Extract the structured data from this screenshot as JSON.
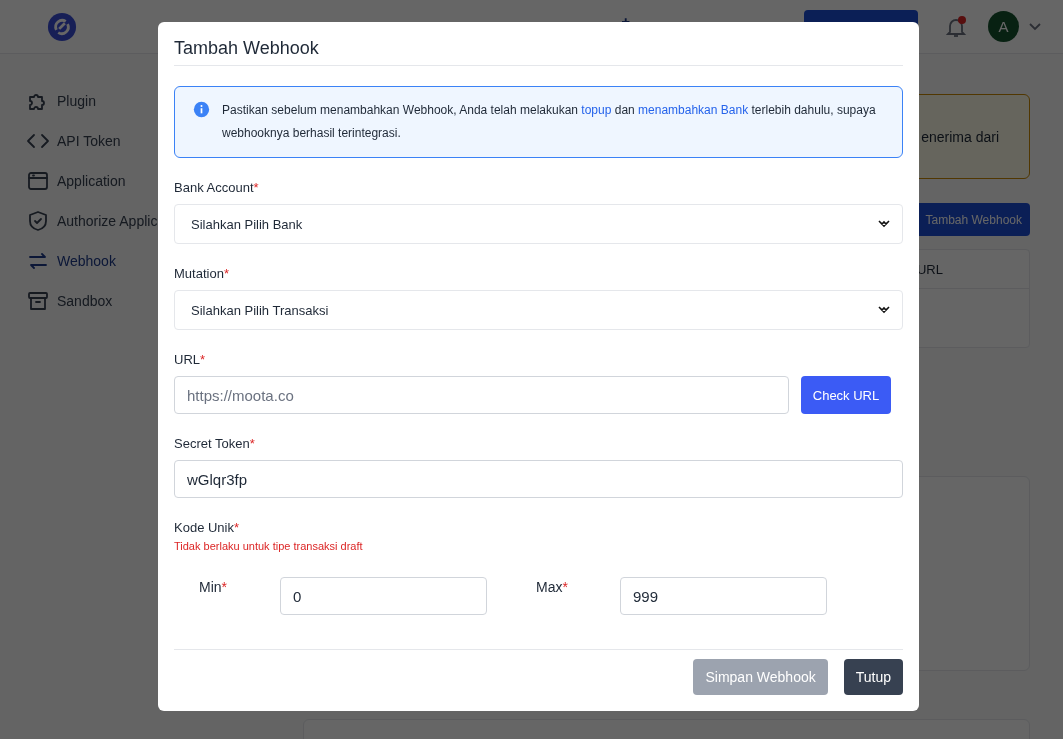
{
  "header": {
    "notification": true,
    "avatar": "A"
  },
  "sidebar": {
    "items": [
      {
        "label": "Plugin",
        "selected": false
      },
      {
        "label": "API Token",
        "selected": false
      },
      {
        "label": "Application",
        "selected": false
      },
      {
        "label": "Authorize Applic",
        "selected": false
      },
      {
        "label": "Webhook",
        "selected": true
      },
      {
        "label": "Sandbox",
        "selected": false
      }
    ]
  },
  "page": {
    "alert_text": "enerima dari",
    "add_button": "Tambah Webhook",
    "table": {
      "columns": [
        "URL"
      ]
    }
  },
  "modal": {
    "title": "Tambah Webhook",
    "info": [
      {
        "kind": "text",
        "text": "Pastikan sebelum menambahkan Webhook, Anda telah melakukan "
      },
      {
        "kind": "link",
        "text": "topup"
      },
      {
        "kind": "text",
        "text": " dan "
      },
      {
        "kind": "link",
        "text": "menambahkan Bank"
      },
      {
        "kind": "text",
        "text": " terlebih dahulu, supaya webhooknya berhasil terintegrasi."
      }
    ],
    "bank_account": {
      "label": "Bank Account",
      "mark": "*",
      "value": "Silahkan Pilih Bank"
    },
    "mutation": {
      "label": "Mutation",
      "mark": "*",
      "value": "Silahkan Pilih Transaksi"
    },
    "url": {
      "label": "URL",
      "mark": "*",
      "placeholder": "https://moota.co",
      "button": "Check URL"
    },
    "secret_token": {
      "label": "Secret Token",
      "mark": "*",
      "value": "wGlqr3fp"
    },
    "kode_unik": {
      "label": "Kode Unik",
      "mark": "*",
      "note": "Tidak berlaku untuk tipe transaksi draft",
      "min": {
        "label": "Min",
        "mark": "*",
        "value": "0"
      },
      "max": {
        "label": "Max",
        "mark": "*",
        "value": "999"
      }
    },
    "buttons": [
      {
        "label": "Simpan Webhook",
        "kind": "primary",
        "disabled": true
      },
      {
        "label": "Tutup",
        "kind": "secondary",
        "disabled": false
      }
    ]
  }
}
